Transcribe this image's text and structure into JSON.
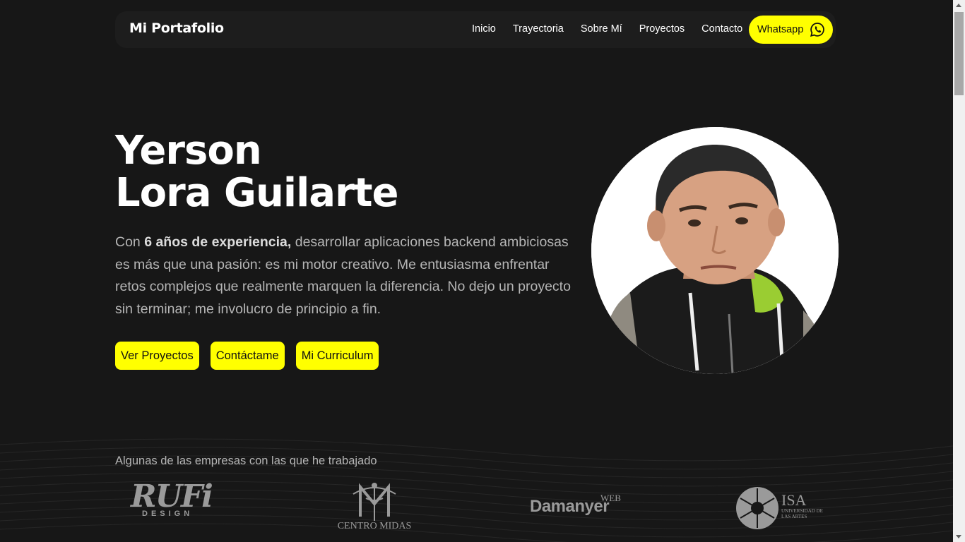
{
  "nav": {
    "brand": "Mi Portafolio",
    "links": [
      "Inicio",
      "Trayectoria",
      "Sobre Mí",
      "Proyectos",
      "Contacto"
    ],
    "whatsapp_label": "Whatsapp"
  },
  "hero": {
    "name_line1": "Yerson",
    "name_line2": "Lora Guilarte",
    "desc_prefix": "Con ",
    "desc_highlight": "6 años de experiencia,",
    "desc_rest": " desarrollar aplicaciones backend ambiciosas es más que una pasión: es mi motor creativo. Me entusiasma enfrentar retos complejos que realmente marquen la diferencia. No dejo un proyecto sin terminar; me involucro de principio a fin.",
    "buttons": [
      "Ver Proyectos",
      "Contáctame",
      "Mi Curriculum"
    ]
  },
  "companies": {
    "title": "Algunas de las empresas con las que he trabajado",
    "logos": [
      {
        "name": "rufi-design",
        "text_main": "RUFi",
        "text_sub": "DESIGN"
      },
      {
        "name": "centro-midas",
        "text_main": "CENTRO MIDAS"
      },
      {
        "name": "damanyer-web",
        "text_main": "Damanyer",
        "text_sub": "WEB"
      },
      {
        "name": "isa",
        "text_main": "ISA",
        "text_sub": "UNIVERSIDAD DE LAS ARTES"
      }
    ]
  },
  "colors": {
    "accent": "#ffff00",
    "background": "#171717",
    "navbar": "#1d1d1d",
    "muted_text": "#b5b5b5"
  },
  "icons": {
    "whatsapp": "whatsapp-icon"
  }
}
